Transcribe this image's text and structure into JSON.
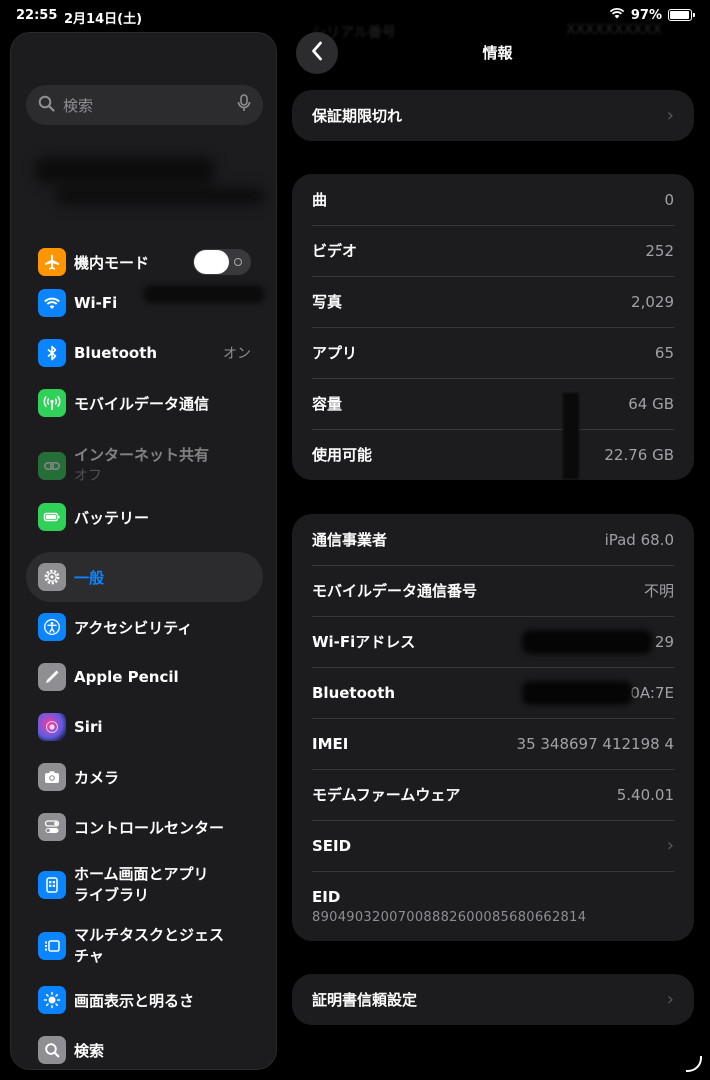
{
  "status_bar": {
    "time": "22:55",
    "date": "2月14日(土)",
    "battery": "97%",
    "battery_level": 0.97
  },
  "search": {
    "placeholder": "検索"
  },
  "sidebar": {
    "items": [
      {
        "label": "機内モード",
        "icon": "airplane-icon",
        "color": "#ff9500",
        "toggle": "off"
      },
      {
        "label": "Wi-Fi",
        "icon": "wifi-icon",
        "color": "#0a84ff"
      },
      {
        "label": "Bluetooth",
        "value": "オン",
        "icon": "bluetooth-icon",
        "color": "#0a84ff"
      },
      {
        "label": "モバイルデータ通信",
        "icon": "antenna-icon",
        "color": "#30d158"
      },
      {
        "label": "インターネット共有",
        "sublabel": "オフ",
        "icon": "link-icon",
        "color": "#30d158"
      },
      {
        "label": "バッテリー",
        "icon": "battery-icon",
        "color": "#30d158"
      },
      {
        "label": "一般",
        "icon": "gear-icon",
        "color": "#8e8e93"
      },
      {
        "label": "アクセシビリティ",
        "icon": "accessibility-icon",
        "color": "#0a84ff"
      },
      {
        "label": "Apple Pencil",
        "icon": "pencil-icon",
        "color": "#8e8e93"
      },
      {
        "label": "Siri",
        "icon": "siri-icon",
        "color": "#5e5ce6"
      },
      {
        "label": "カメラ",
        "icon": "camera-icon",
        "color": "#8e8e93"
      },
      {
        "label": "コントロールセンター",
        "icon": "switches-icon",
        "color": "#8e8e93"
      },
      {
        "label": "ホーム画面とアプリ",
        "label2": "ライブラリ",
        "icon": "homescreen-icon",
        "color": "#0a84ff"
      },
      {
        "label": "マルチタスクとジェス",
        "label2": "チャ",
        "icon": "multitask-icon",
        "color": "#0a84ff"
      },
      {
        "label": "画面表示と明るさ",
        "icon": "brightness-icon",
        "color": "#0a84ff"
      },
      {
        "label": "検索",
        "icon": "search-icon",
        "color": "#8e8e93"
      }
    ]
  },
  "detail": {
    "title": "情報",
    "warranty": {
      "label": "保証期限切れ"
    },
    "media": [
      {
        "label": "曲",
        "value": "0"
      },
      {
        "label": "ビデオ",
        "value": "252"
      },
      {
        "label": "写真",
        "value": "2,029"
      },
      {
        "label": "アプリ",
        "value": "65"
      },
      {
        "label": "容量",
        "value": "64 GB"
      },
      {
        "label": "使用可能",
        "value": "22.76 GB"
      }
    ],
    "network": [
      {
        "label": "通信事業者",
        "value": "iPad 68.0"
      },
      {
        "label": "モバイルデータ通信番号",
        "value": "不明"
      },
      {
        "label": "Wi-Fiアドレス",
        "value": "29"
      },
      {
        "label": "Bluetooth",
        "value": "0A:7E"
      },
      {
        "label": "IMEI",
        "value": "35 348697 412198 4"
      },
      {
        "label": "モデムファームウェア",
        "value": "5.40.01"
      },
      {
        "label": "SEID",
        "value": ""
      },
      {
        "label": "EID",
        "value": "89049032007008882600085680662814"
      }
    ],
    "certificate": {
      "label": "証明書信頼設定"
    }
  }
}
